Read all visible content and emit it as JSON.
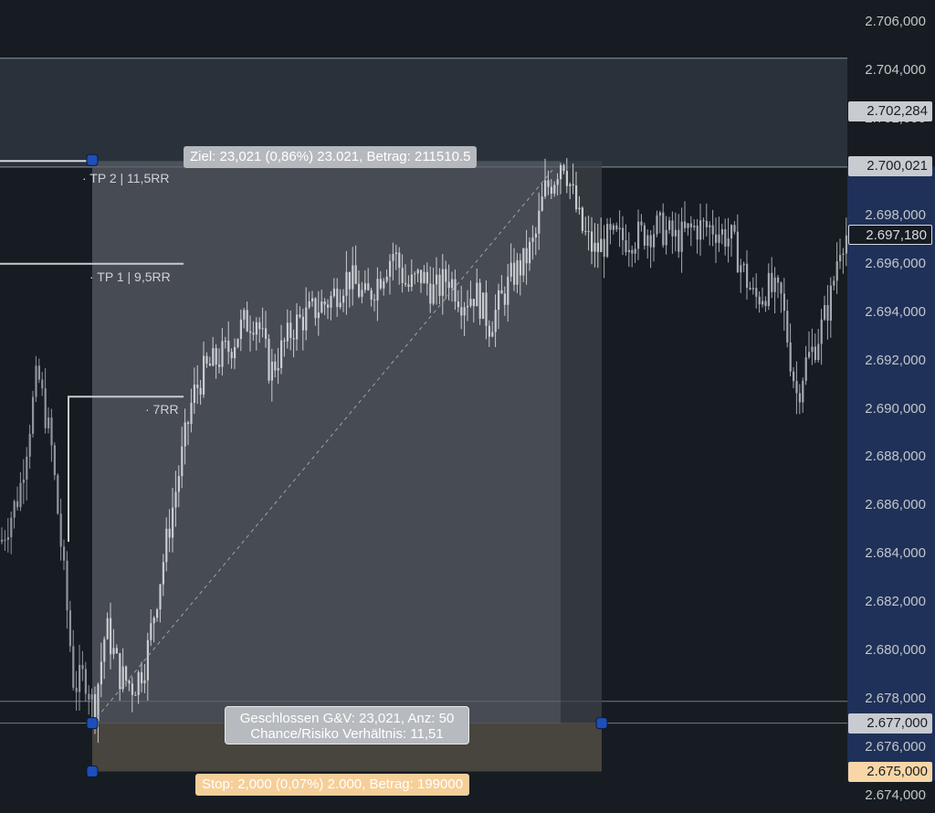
{
  "chart_data": {
    "type": "candlestick",
    "y_axis": {
      "position": "right",
      "ylim": [
        2.674,
        2.706
      ],
      "tick_labels": [
        "2.706,000",
        "2.704,000",
        "2.702,000",
        "2.700,000",
        "2.698,000",
        "2.696,000",
        "2.694,000",
        "2.692,000",
        "2.690,000",
        "2.688,000",
        "2.686,000",
        "2.684,000",
        "2.682,000",
        "2.680,000",
        "2.678,000",
        "2.676,000",
        "2.674,000"
      ],
      "price_badges": [
        {
          "label": "2.702,284",
          "value": 2.702284,
          "style": "grey"
        },
        {
          "label": "2.700,021",
          "value": 2.700021,
          "style": "grey"
        },
        {
          "label": "2.697,180",
          "value": 2.69718,
          "style": "last"
        },
        {
          "label": "2.677,000",
          "value": 2.677,
          "style": "grey"
        },
        {
          "label": "2.675,000",
          "value": 2.675,
          "style": "stop"
        }
      ]
    },
    "position_tool": {
      "entry": 2.677,
      "target": 2.700021,
      "stop": 2.675,
      "target_label": "Ziel: 23,021 (0,86%) 23.021, Betrag: 211510.5",
      "closed_label_line1": "Geschlossen G&V: 23,021, Anz: 50",
      "closed_label_line2": "Chance/Risiko Verhältnis: 11,51",
      "stop_label": "Stop: 2,000 (0,07%) 2.000, Betrag: 199000",
      "rr_levels": [
        {
          "label": "· TP 2 | 11,5RR",
          "value": 2.700021
        },
        {
          "label": "· TP 1 | 9,5RR",
          "value": 2.696
        },
        {
          "label": "· 7RR",
          "value": 2.6905
        }
      ]
    },
    "zones": [
      {
        "from": 2.7,
        "to": 2.7045
      },
      {
        "from": 2.6769,
        "to": 2.6779
      }
    ],
    "price_path": [
      [
        0,
        2.6845
      ],
      [
        20,
        2.6865
      ],
      [
        40,
        2.6915
      ],
      [
        55,
        2.6885
      ],
      [
        68,
        2.6835
      ],
      [
        80,
        2.6785
      ],
      [
        92,
        2.679
      ],
      [
        102,
        2.6775
      ],
      [
        115,
        2.681
      ],
      [
        130,
        2.679
      ],
      [
        145,
        2.6785
      ],
      [
        158,
        2.6795
      ],
      [
        172,
        2.6825
      ],
      [
        186,
        2.6855
      ],
      [
        198,
        2.688
      ],
      [
        210,
        2.6905
      ],
      [
        222,
        2.6915
      ],
      [
        236,
        2.692
      ],
      [
        250,
        2.6925
      ],
      [
        265,
        2.6935
      ],
      [
        280,
        2.6938
      ],
      [
        295,
        2.6915
      ],
      [
        308,
        2.6925
      ],
      [
        322,
        2.6935
      ],
      [
        340,
        2.694
      ],
      [
        360,
        2.6945
      ],
      [
        380,
        2.6955
      ],
      [
        400,
        2.6945
      ],
      [
        415,
        2.6955
      ],
      [
        430,
        2.6965
      ],
      [
        445,
        2.695
      ],
      [
        460,
        2.6955
      ],
      [
        475,
        2.6948
      ],
      [
        490,
        2.6955
      ],
      [
        505,
        2.6945
      ],
      [
        520,
        2.6948
      ],
      [
        535,
        2.6935
      ],
      [
        548,
        2.6945
      ],
      [
        560,
        2.6955
      ],
      [
        572,
        2.696
      ],
      [
        585,
        2.697
      ],
      [
        595,
        2.699
      ],
      [
        605,
        2.6995
      ],
      [
        615,
        2.7005
      ],
      [
        625,
        2.699
      ],
      [
        635,
        2.6975
      ],
      [
        650,
        2.6965
      ],
      [
        665,
        2.697
      ],
      [
        680,
        2.697
      ],
      [
        700,
        2.6972
      ],
      [
        720,
        2.6975
      ],
      [
        740,
        2.697
      ],
      [
        760,
        2.6975
      ],
      [
        780,
        2.6975
      ],
      [
        800,
        2.697
      ],
      [
        812,
        2.6958
      ],
      [
        825,
        2.6945
      ],
      [
        840,
        2.695
      ],
      [
        855,
        2.6945
      ],
      [
        865,
        2.692
      ],
      [
        872,
        2.6905
      ],
      [
        880,
        2.6918
      ],
      [
        890,
        2.6925
      ],
      [
        900,
        2.6935
      ],
      [
        910,
        2.6948
      ],
      [
        918,
        2.6968
      ],
      [
        924,
        2.6972
      ]
    ]
  }
}
